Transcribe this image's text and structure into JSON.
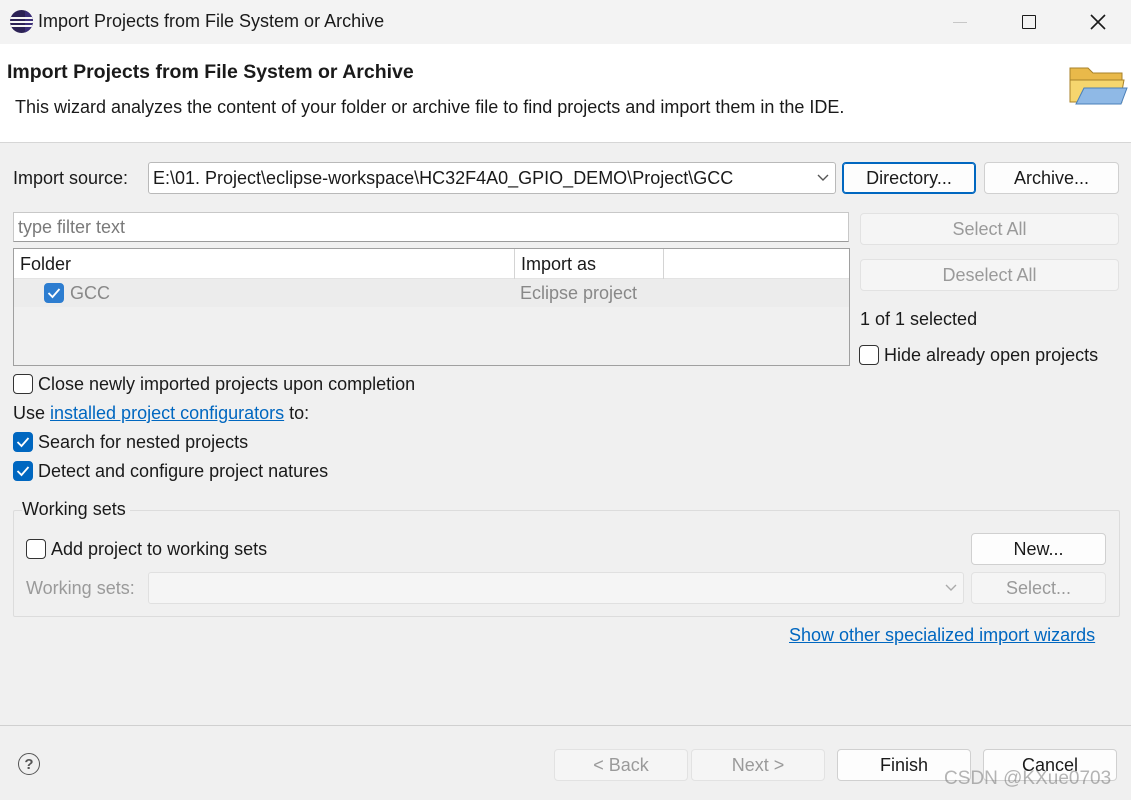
{
  "window": {
    "title": "Import Projects from File System or Archive"
  },
  "header": {
    "title": "Import Projects from File System or Archive",
    "description": "This wizard analyzes the content of your folder or archive file to find projects and import them in the IDE."
  },
  "import_source": {
    "label": "Import source:",
    "value": "E:\\01. Project\\eclipse-workspace\\HC32F4A0_GPIO_DEMO\\Project\\GCC",
    "directory_button": "Directory...",
    "archive_button": "Archive..."
  },
  "filter": {
    "placeholder": "type filter text"
  },
  "projects_table": {
    "columns": [
      "Folder",
      "Import as"
    ],
    "rows": [
      {
        "folder": "GCC",
        "import_as": "Eclipse project",
        "checked": true
      }
    ]
  },
  "side_panel": {
    "select_all": "Select All",
    "deselect_all": "Deselect All",
    "selection_count": "1 of 1 selected",
    "hide_open_label": "Hide already open projects",
    "hide_open_checked": false
  },
  "options": {
    "close_after_import_label": "Close newly imported projects upon completion",
    "close_after_import_checked": false,
    "use_prefix": "Use ",
    "configurators_link": "installed project configurators",
    "use_suffix": " to:",
    "search_nested_label": "Search for nested projects",
    "search_nested_checked": true,
    "detect_natures_label": "Detect and configure project natures",
    "detect_natures_checked": true
  },
  "working_sets": {
    "title": "Working sets",
    "add_label": "Add project to working sets",
    "add_checked": false,
    "new_button": "New...",
    "sets_label": "Working sets:",
    "sets_value": "",
    "select_button": "Select..."
  },
  "specialized_link": "Show other specialized import wizards",
  "footer": {
    "help": "?",
    "back": "< Back",
    "next": "Next >",
    "finish": "Finish",
    "cancel": "Cancel"
  },
  "watermark": "CSDN @KXue0703",
  "colors": {
    "accent": "#0067c0",
    "dialog_bg": "#f0f0f0",
    "header_bg": "#ffffff",
    "disabled_text": "#9a9a9a"
  },
  "icons": [
    "eclipse-icon",
    "minimize-icon",
    "maximize-icon",
    "close-icon",
    "folder-icon",
    "chevron-down-icon",
    "checkmark-icon",
    "help-icon"
  ]
}
